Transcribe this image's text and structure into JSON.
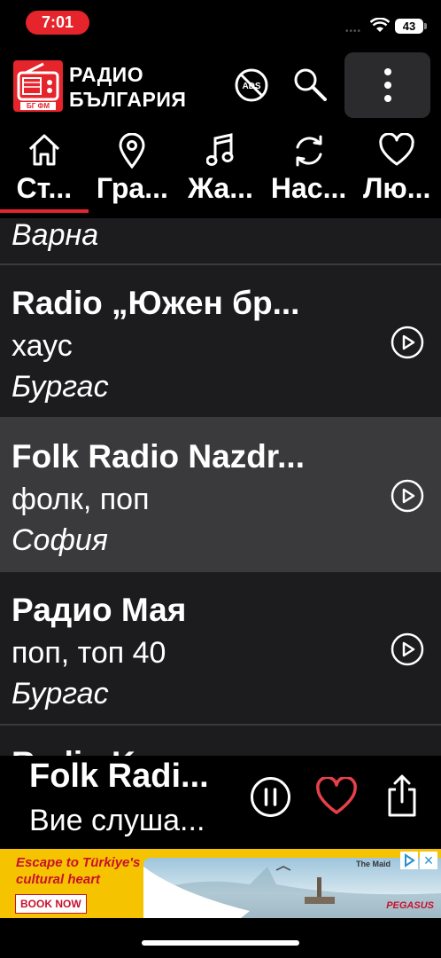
{
  "status": {
    "time": "7:01",
    "battery": "43"
  },
  "header": {
    "logo_line1": "РАДИО",
    "logo_line2": "БЪЛГАРИЯ",
    "logo_badge": "БГ ФМ",
    "ads_label": "ADS"
  },
  "tabs": [
    {
      "label": "Ст...",
      "icon": "home-icon",
      "active": true
    },
    {
      "label": "Гра...",
      "icon": "location-pin-icon",
      "active": false
    },
    {
      "label": "Жа...",
      "icon": "music-note-icon",
      "active": false
    },
    {
      "label": "Нас...",
      "icon": "refresh-icon",
      "active": false
    },
    {
      "label": "Лю...",
      "icon": "heart-icon",
      "active": false
    }
  ],
  "list": {
    "partial_top_city": "Варна",
    "rows": [
      {
        "title": "Radio „Южен бр...",
        "genre": "хаус",
        "city": "Бургас"
      },
      {
        "title": "Folk Radio Nazdr...",
        "genre": "фолк, поп",
        "city": "София"
      },
      {
        "title": "Радио Мая",
        "genre": "поп, топ 40",
        "city": "Бургас"
      }
    ],
    "partial_bottom_title": "Radio Kasarovo"
  },
  "now_playing": {
    "title": "Folk Radi...",
    "subtitle": "Вие слуша..."
  },
  "ad": {
    "line1": "Escape to Türkiye's",
    "line2": "cultural heart",
    "cta": "BOOK NOW",
    "location_tag": "The Maid",
    "brand": "PEGASUS"
  },
  "colors": {
    "accent": "#e5242b",
    "list_bg": "#1c1c1e",
    "selected_bg": "#3a3a3c",
    "ad_bg": "#f6c300"
  }
}
